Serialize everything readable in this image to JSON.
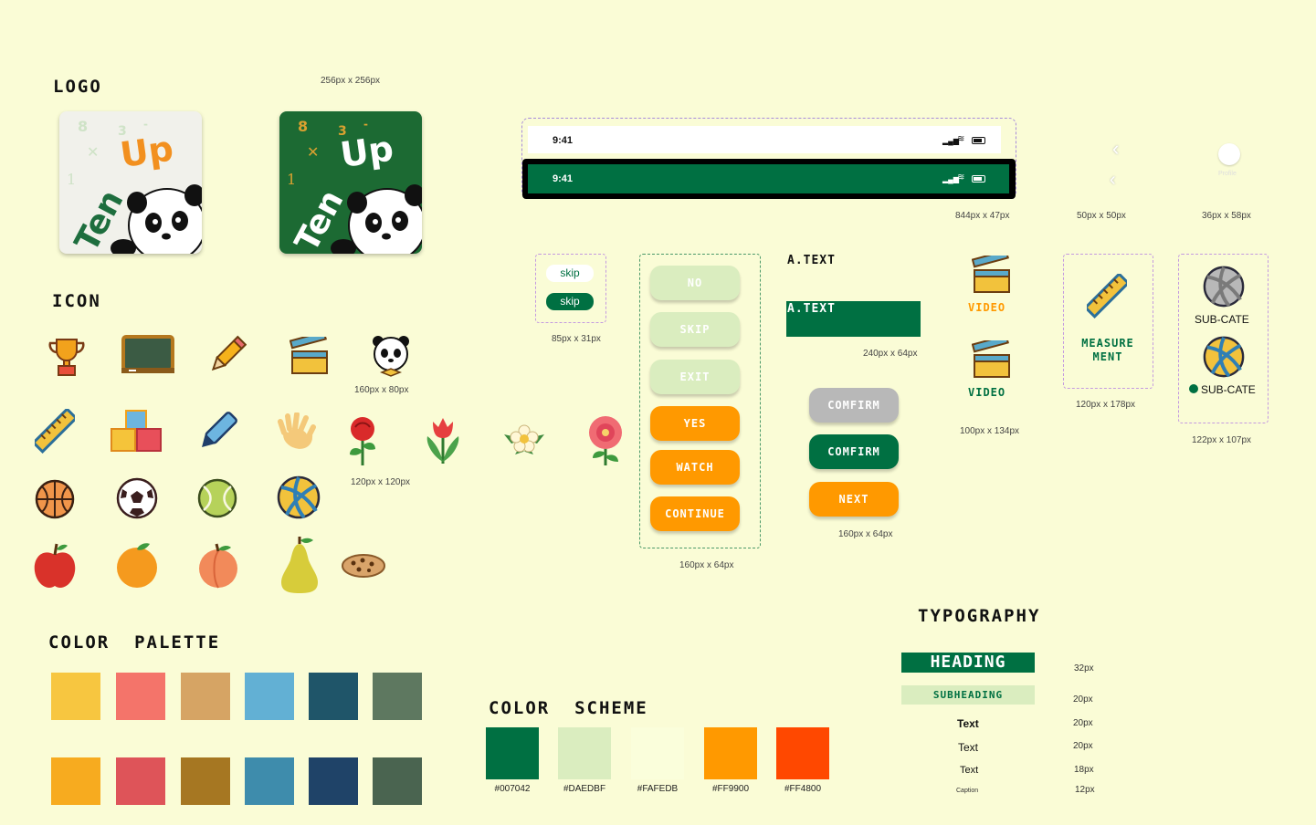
{
  "sections": {
    "logo": "LOGO",
    "icon": "ICON",
    "palette": "COLOR  PALETTE",
    "scheme": "COLOR  SCHEME",
    "typography": "TYPOGRAPHY"
  },
  "logo": {
    "size": "256px x 256px",
    "mark": "Ten Up"
  },
  "statusbar": {
    "time1": "9:41",
    "time2": "9:41",
    "size": "844px x 47px"
  },
  "back": {
    "size": "50px x 50px"
  },
  "profile": {
    "label": "Profile",
    "size": "36px x 58px"
  },
  "skip": {
    "label1": "skip",
    "label2": "skip",
    "size": "85px x 31px"
  },
  "buttons_column": {
    "labels": [
      "NO",
      "SKIP",
      "EXIT",
      "YES",
      "WATCH",
      "CONTINUE"
    ],
    "size": "160px x 64px"
  },
  "answer": {
    "label1": "A.TEXT",
    "label2": "A.TEXT",
    "size": "240px x 64px"
  },
  "confirm": {
    "labels": [
      "COMFIRM",
      "COMFIRM",
      "NEXT"
    ],
    "size": "160px x 64px"
  },
  "video": {
    "label1": "VIDEO",
    "label2": "VIDEO",
    "size": "100px x 134px"
  },
  "measure": {
    "label": "MEASURE MENT",
    "size": "120px x 178px"
  },
  "subcate": {
    "label1": "SUB-CATE",
    "label2": "SUB-CATE",
    "size": "122px x 107px"
  },
  "icons": {
    "row1": [
      "trophy-icon",
      "chalkboard-icon",
      "pencil-icon",
      "clapperboard-icon",
      "panda-icon"
    ],
    "row1_size": "160px x 80px",
    "row2": [
      "ruler-icon",
      "blocks-icon",
      "marker-icon",
      "hand-icon",
      "rose-icon",
      "tulip-icon",
      "flower-icon",
      "camellia-icon"
    ],
    "row2_size": "120px x 120px",
    "row3": [
      "basketball-icon",
      "soccer-ball-icon",
      "tennis-ball-icon",
      "volleyball-icon"
    ],
    "row4": [
      "apple-icon",
      "orange-icon",
      "peach-icon",
      "pear-icon",
      "cookie-icon"
    ]
  },
  "palette": {
    "row1": [
      "#F7C640",
      "#F4746A",
      "#D6A464",
      "#62B0D4",
      "#1F5569",
      "#5E7860"
    ],
    "row2": [
      "#F7AB1F",
      "#DE5459",
      "#A67722",
      "#3E8CAC",
      "#1F4368",
      "#4A6450"
    ]
  },
  "scheme": [
    {
      "hex": "#007042",
      "label": "#007042"
    },
    {
      "hex": "#DAEDBF",
      "label": "#DAEDBF"
    },
    {
      "hex": "#FAFEDB",
      "label": "#FAFEDB"
    },
    {
      "hex": "#FF9900",
      "label": "#FF9900"
    },
    {
      "hex": "#FF4800",
      "label": "#FF4800"
    }
  ],
  "typography": {
    "heading": "HEADING",
    "heading_size": "32px",
    "subheading": "SUBHEADING",
    "subheading_size": "20px",
    "text1": "Text",
    "text1_size": "20px",
    "text2": "Text",
    "text2_size": "20px",
    "text3": "Text",
    "text3_size": "18px",
    "caption": "Caption",
    "caption_size": "12px"
  },
  "colors": {
    "green": "#007042",
    "light_green": "#DAEDBF",
    "orange": "#FF9900",
    "grey": "#B8B8B8",
    "background": "#FAFCD6"
  }
}
